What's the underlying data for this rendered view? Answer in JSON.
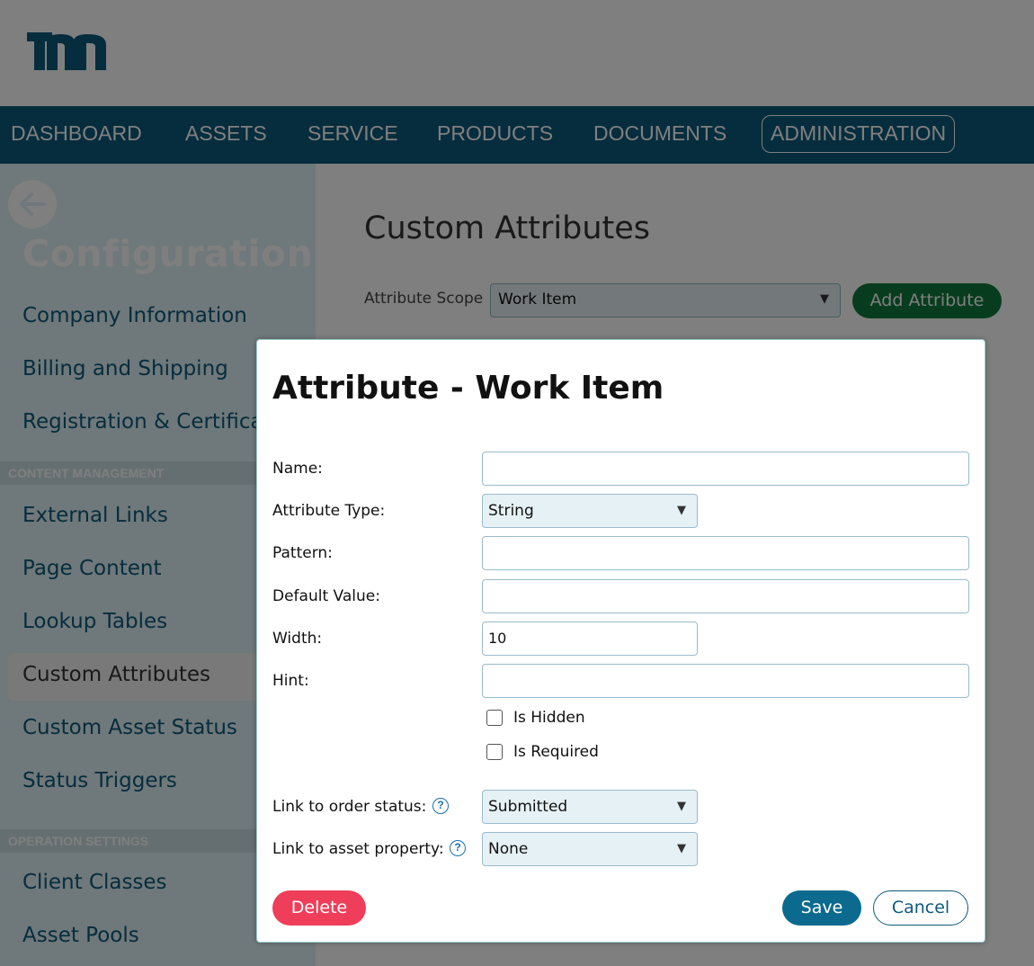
{
  "nav": {
    "items": [
      "DASHBOARD",
      "ASSETS",
      "SERVICE",
      "PRODUCTS",
      "DOCUMENTS",
      "ADMINISTRATION"
    ]
  },
  "sidebar": {
    "title": "Configuration",
    "items_top": [
      "Company Information",
      "Billing and Shipping",
      "Registration & Certificat"
    ],
    "section_content": "CONTENT MANAGEMENT",
    "items_content": [
      "External Links",
      "Page Content",
      "Lookup Tables",
      "Custom Attributes",
      "Custom Asset Status",
      "Status Triggers"
    ],
    "section_operation": "OPERATION SETTINGS",
    "items_operation": [
      "Client Classes",
      "Asset Pools"
    ]
  },
  "main": {
    "title": "Custom Attributes",
    "scope_label": "Attribute Scope",
    "scope_value": "Work Item",
    "add_button": "Add Attribute"
  },
  "modal": {
    "title": "Attribute - Work Item",
    "labels": {
      "name": "Name:",
      "type": "Attribute Type:",
      "pattern": "Pattern:",
      "default": "Default Value:",
      "width": "Width:",
      "hint": "Hint:",
      "order_status": "Link to order status:",
      "asset_property": "Link to asset property:"
    },
    "values": {
      "name": "",
      "type": "String",
      "pattern": "",
      "default": "",
      "width": "10",
      "hint": "",
      "order_status": "Submitted",
      "asset_property": "None"
    },
    "checkboxes": {
      "hidden": "Is Hidden",
      "required": "Is Required"
    },
    "buttons": {
      "delete": "Delete",
      "save": "Save",
      "cancel": "Cancel"
    }
  },
  "colors": {
    "brand": "#0c5a7a",
    "add": "#0e7a3c",
    "delete": "#ef3e5a",
    "save": "#0c6a8e"
  },
  "icons": {
    "caret": "▼",
    "help": "?",
    "back": "arrow-left-icon"
  }
}
